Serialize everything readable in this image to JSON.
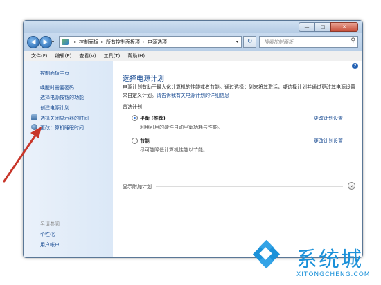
{
  "window": {
    "controls": {
      "minimize": "—",
      "maximize": "□",
      "close": "✕"
    }
  },
  "nav": {
    "back_glyph": "◀",
    "forward_glyph": "▶",
    "dropdown_glyph": "▾",
    "breadcrumb": [
      "控制面板",
      "所有控制面板项",
      "电源选项"
    ],
    "separator_glyph": "▸",
    "refresh_glyph": "↻",
    "search_placeholder": "搜索控制面板",
    "search_glyph": "⚲"
  },
  "menubar": [
    "文件(F)",
    "编辑(E)",
    "查看(V)",
    "工具(T)",
    "帮助(H)"
  ],
  "sidebar": {
    "home": "控制面板主页",
    "items": [
      "唤醒时需要密码",
      "选择电源按钮的功能",
      "创建电源计划",
      "选择关闭显示器的时间",
      "更改计算机睡眠时间"
    ],
    "see_also_title": "另请参阅",
    "see_also": [
      "个性化",
      "用户帐户"
    ]
  },
  "main": {
    "help_glyph": "?",
    "title": "选择电源计划",
    "description": "电源计划有助于最大化计算机的性能或者节能。通过选择计划来将其激活，或选择计划并通过更改其电源设置来自定义计划。",
    "description_link": "请告诉我有关电源计划的详细信息",
    "group_title": "首选计划",
    "plans": [
      {
        "name": "平衡 (推荐)",
        "description": "利用可用的硬件自动平衡功耗与性能。",
        "link": "更改计划设置",
        "selected": true
      },
      {
        "name": "节能",
        "description": "尽可能降低计算机性能以节能。",
        "link": "更改计划设置",
        "selected": false
      }
    ],
    "show_more": "显示附加计划",
    "expand_glyph": "⌄"
  },
  "watermark": {
    "text": "系统城",
    "url_text": "XITONGCHENG.COM"
  }
}
